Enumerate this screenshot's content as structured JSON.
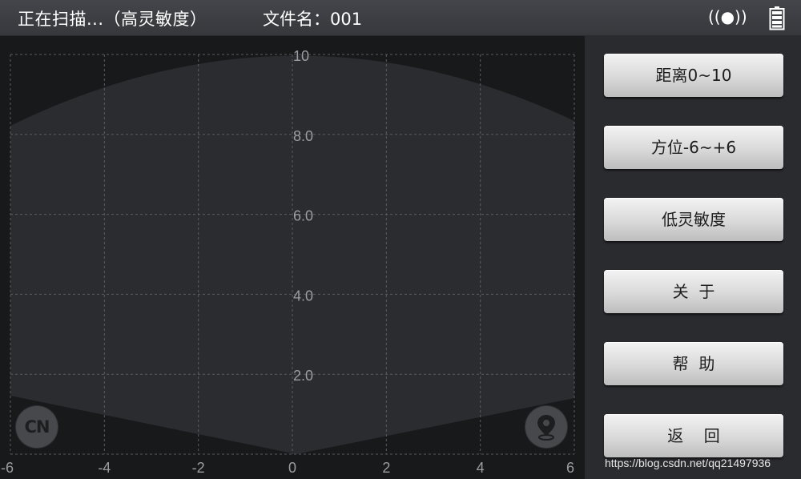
{
  "header": {
    "status": "正在扫描...（高灵敏度）",
    "file_label": "文件名：001",
    "signal_glyph": "((●))",
    "signal_icon": "signal-icon",
    "battery_icon": "battery-icon"
  },
  "plot": {
    "y_labels": [
      "10",
      "8.0",
      "6.0",
      "4.0",
      "2.0"
    ],
    "x_labels": [
      "-6",
      "-4",
      "-2",
      "0",
      "2",
      "4",
      "6"
    ],
    "grid": "dashed",
    "colors": {
      "background": "#18191b",
      "coverage": "#2b2c30",
      "grid": "#5a5c60",
      "label": "#9b9da0"
    }
  },
  "sidebar": {
    "buttons": [
      {
        "label": "距离0~10"
      },
      {
        "label": "方位-6~+6"
      },
      {
        "label": "低灵敏度"
      },
      {
        "label": "关  于"
      },
      {
        "label": "帮  助"
      },
      {
        "label": "返    回"
      }
    ]
  },
  "badges": {
    "cn": "CN",
    "location_icon": "location-pin-icon"
  },
  "watermark": "https://blog.csdn.net/qq21497936"
}
